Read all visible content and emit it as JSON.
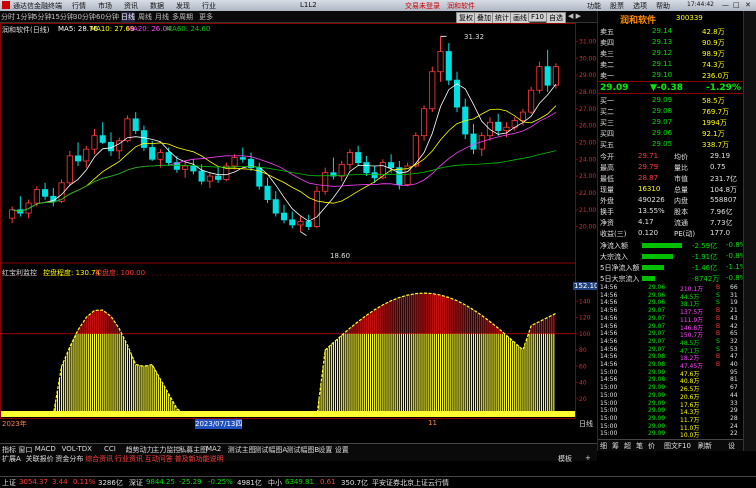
{
  "colors": {
    "up": "#ff3b3b",
    "down": "#00e0e0",
    "ma5": "#ffffff",
    "ma10": "#ffff00",
    "ma20": "#ff40ff",
    "ma60": "#00c000",
    "bull": "#ffff30",
    "hot": "#c01010"
  },
  "titlebar": {
    "app": "通达信金融终端",
    "menu": [
      "行情",
      "市场",
      "资讯",
      "数据",
      "发现",
      "行业",
      "L1L2"
    ],
    "notice": "交易未登录",
    "broker": "润和软件",
    "right": [
      "功能",
      "股票",
      "选项",
      "帮助"
    ]
  },
  "subbar": {
    "periods": [
      "分时",
      "1分钟",
      "5分钟",
      "15分钟",
      "30分钟",
      "60分钟",
      "日线",
      "周线",
      "月线",
      "多周期",
      "更多"
    ],
    "active": "日线",
    "tools": [
      "复权",
      "叠加",
      "统计",
      "画线",
      "F10",
      "自选"
    ],
    "nav": "◀ ▶"
  },
  "main": {
    "header": "润和软件(日线)",
    "ma": [
      {
        "label": "MA5: 28.76",
        "color": "#ffffff"
      },
      {
        "label": "MA10: 27.69",
        "color": "#ffff00"
      },
      {
        "label": "MA20: 26.04",
        "color": "#ff40ff"
      },
      {
        "label": "MA60: 24.60",
        "color": "#00c000"
      }
    ],
    "price_ticks": [
      "31.00",
      "30.00",
      "29.00",
      "28.00",
      "27.00",
      "26.00",
      "25.00",
      "24.00",
      "23.00",
      "22.00",
      "21.00",
      "20.00"
    ],
    "high_label": "31.32",
    "low_label": "18.60",
    "indicator": {
      "name": "红宝利监控",
      "label1": "控盘程度: 130.74",
      "label2": "控盘度: 100.00",
      "value": "152.10",
      "ticks": [
        "140",
        "120",
        "100",
        "80",
        "60",
        "40",
        "20"
      ]
    },
    "dates": [
      "2023年",
      "2023/07/13四",
      "11"
    ],
    "date_tag": "日线"
  },
  "candles": [
    [
      20.5,
      21.2,
      20.2,
      21.0
    ],
    [
      21.0,
      21.8,
      20.6,
      20.8
    ],
    [
      20.8,
      21.6,
      20.5,
      21.4
    ],
    [
      21.4,
      22.4,
      21.2,
      22.2
    ],
    [
      22.2,
      22.6,
      21.6,
      21.8
    ],
    [
      21.8,
      22.3,
      21.2,
      21.5
    ],
    [
      21.5,
      22.8,
      21.4,
      22.6
    ],
    [
      22.6,
      24.5,
      22.4,
      24.2
    ],
    [
      24.2,
      25.0,
      23.6,
      23.9
    ],
    [
      23.9,
      24.8,
      23.5,
      24.6
    ],
    [
      24.6,
      25.8,
      24.3,
      25.4
    ],
    [
      25.4,
      26.2,
      24.9,
      25.0
    ],
    [
      25.0,
      25.6,
      24.2,
      24.5
    ],
    [
      24.5,
      25.3,
      24.0,
      25.1
    ],
    [
      25.1,
      26.6,
      25.0,
      26.4
    ],
    [
      26.4,
      26.8,
      25.5,
      25.7
    ],
    [
      25.7,
      26.0,
      24.5,
      24.7
    ],
    [
      24.7,
      25.1,
      23.9,
      24.0
    ],
    [
      24.0,
      24.6,
      23.5,
      24.4
    ],
    [
      24.4,
      24.7,
      23.6,
      23.8
    ],
    [
      23.8,
      24.2,
      23.2,
      23.4
    ],
    [
      23.4,
      23.9,
      22.9,
      23.6
    ],
    [
      23.6,
      24.0,
      23.1,
      23.3
    ],
    [
      23.3,
      23.7,
      22.5,
      22.7
    ],
    [
      22.7,
      23.2,
      22.3,
      23.0
    ],
    [
      23.0,
      23.5,
      22.6,
      22.8
    ],
    [
      22.8,
      23.8,
      22.7,
      23.6
    ],
    [
      23.6,
      24.3,
      23.4,
      24.1
    ],
    [
      24.1,
      24.7,
      23.8,
      24.0
    ],
    [
      24.0,
      24.4,
      23.3,
      23.5
    ],
    [
      23.5,
      23.8,
      22.2,
      22.4
    ],
    [
      22.4,
      22.9,
      21.4,
      21.6
    ],
    [
      21.6,
      22.1,
      20.6,
      20.8
    ],
    [
      20.8,
      21.3,
      20.2,
      20.4
    ],
    [
      20.4,
      20.9,
      19.9,
      20.1
    ],
    [
      20.1,
      20.6,
      19.7,
      20.3
    ],
    [
      20.3,
      20.7,
      19.8,
      20.0
    ],
    [
      20.0,
      22.4,
      19.9,
      22.1
    ],
    [
      22.1,
      23.5,
      21.9,
      23.2
    ],
    [
      23.2,
      24.1,
      22.8,
      23.0
    ],
    [
      23.0,
      23.9,
      22.7,
      23.7
    ],
    [
      23.7,
      24.6,
      23.4,
      24.4
    ],
    [
      24.4,
      24.8,
      23.6,
      23.8
    ],
    [
      23.8,
      24.2,
      23.0,
      23.2
    ],
    [
      23.2,
      23.6,
      22.6,
      22.9
    ],
    [
      22.9,
      24.0,
      22.8,
      23.8
    ],
    [
      23.8,
      24.3,
      23.2,
      23.5
    ],
    [
      23.5,
      23.9,
      22.2,
      22.5
    ],
    [
      22.5,
      23.8,
      22.4,
      23.6
    ],
    [
      23.6,
      25.6,
      23.5,
      25.4
    ],
    [
      25.4,
      27.2,
      25.1,
      27.0
    ],
    [
      27.0,
      29.5,
      26.8,
      29.2
    ],
    [
      29.2,
      31.3,
      28.6,
      30.4
    ],
    [
      30.4,
      30.9,
      28.4,
      28.7
    ],
    [
      28.7,
      29.2,
      26.8,
      27.1
    ],
    [
      27.1,
      27.6,
      25.2,
      25.5
    ],
    [
      25.5,
      26.1,
      24.3,
      24.6
    ],
    [
      24.6,
      25.6,
      24.2,
      25.4
    ],
    [
      25.4,
      26.5,
      25.1,
      26.2
    ],
    [
      26.2,
      26.7,
      25.4,
      25.7
    ],
    [
      25.7,
      26.2,
      25.3,
      25.9
    ],
    [
      25.9,
      26.5,
      25.7,
      26.3
    ],
    [
      26.3,
      27.0,
      26.0,
      26.8
    ],
    [
      26.8,
      28.3,
      26.7,
      28.1
    ],
    [
      28.1,
      29.8,
      27.9,
      29.5
    ],
    [
      29.5,
      30.5,
      28.0,
      28.4
    ],
    [
      28.4,
      29.7,
      28.2,
      29.5
    ]
  ],
  "right": {
    "logo": "润和软件",
    "code": "300339",
    "price": "29.09",
    "change": "▼-0.38",
    "pct": "-1.29%",
    "sell": [
      {
        "l": "卖五",
        "p": "29.14",
        "v": "42.8万"
      },
      {
        "l": "卖四",
        "p": "29.13",
        "v": "90.9万"
      },
      {
        "l": "卖三",
        "p": "29.12",
        "v": "98.9万"
      },
      {
        "l": "卖二",
        "p": "29.11",
        "v": "74.3万"
      },
      {
        "l": "卖一",
        "p": "29.10",
        "v": "236.0万"
      }
    ],
    "buy": [
      {
        "l": "买一",
        "p": "29.09",
        "v": "58.5万"
      },
      {
        "l": "买二",
        "p": "29.08",
        "v": "769.7万"
      },
      {
        "l": "买三",
        "p": "29.07",
        "v": "1994万"
      },
      {
        "l": "买四",
        "p": "29.06",
        "v": "92.1万"
      },
      {
        "l": "买五",
        "p": "29.05",
        "v": "338.7万"
      }
    ],
    "stats": [
      {
        "a": "今开",
        "b": "29.71",
        "c": "均价",
        "d": "29.19"
      },
      {
        "a": "最高",
        "b": "29.79",
        "c": "量比",
        "d": "0.75"
      },
      {
        "a": "最低",
        "b": "28.87",
        "c": "市值",
        "d": "231.7亿"
      },
      {
        "a": "现量",
        "b": "16310",
        "c": "总量",
        "d": "104.8万"
      },
      {
        "a": "外盘",
        "b": "490226",
        "c": "内盘",
        "d": "558807"
      },
      {
        "a": "换手",
        "b": "13.55%",
        "c": "股本",
        "d": "7.96亿"
      },
      {
        "a": "净资",
        "b": "4.17",
        "c": "流通",
        "d": "7.73亿"
      },
      {
        "a": "收益(三)",
        "b": "0.120",
        "c": "PE(动)",
        "d": "177.0"
      }
    ],
    "flows": [
      {
        "l": "净流入额",
        "v": "-2.59亿",
        "p": "-0.8%",
        "w": 0.9
      },
      {
        "l": "大宗流入",
        "v": "-1.91亿",
        "p": "-0.8%",
        "w": 0.7
      },
      {
        "l": "5日净流入额",
        "v": "-1.46亿",
        "p": "-1.1%",
        "w": 0.5
      },
      {
        "l": "5日大宗流入",
        "v": "-8742万",
        "p": "-0.8%",
        "w": 0.3
      }
    ],
    "ticks": [
      [
        "14:56",
        "29.06",
        "210.1万",
        "B",
        "66"
      ],
      [
        "14:56",
        "29.06",
        "44.5万",
        "S",
        "31"
      ],
      [
        "14:56",
        "29.06",
        "38.1万",
        "S",
        "19"
      ],
      [
        "14:56",
        "29.07",
        "137.5万",
        "B",
        "21"
      ],
      [
        "14:56",
        "29.07",
        "111.9万",
        "B",
        "43"
      ],
      [
        "14:56",
        "29.07",
        "146.8万",
        "B",
        "42"
      ],
      [
        "14:56",
        "29.07",
        "150.7万",
        "B",
        "65"
      ],
      [
        "14:56",
        "29.07",
        "48.5万",
        "S",
        "32"
      ],
      [
        "14:56",
        "29.07",
        "47.1万",
        "S",
        "53"
      ],
      [
        "14:56",
        "29.08",
        "18.2万",
        "B",
        "47"
      ],
      [
        "14:56",
        "29.08",
        "47.45万",
        "B",
        "40"
      ],
      [
        "15:00",
        "29.09",
        "47.6万",
        "",
        "95"
      ],
      [
        "14:56",
        "29.08",
        "40.8万",
        "",
        "81"
      ],
      [
        "15:00",
        "29.09",
        "26.5万",
        "",
        "67"
      ],
      [
        "15:00",
        "29.09",
        "20.6万",
        "",
        "44"
      ],
      [
        "15:00",
        "29.09",
        "17.6万",
        "",
        "33"
      ],
      [
        "15:00",
        "29.09",
        "14.3万",
        "",
        "29"
      ],
      [
        "15:00",
        "29.09",
        "11.7万",
        "",
        "28"
      ],
      [
        "15:00",
        "29.09",
        "11.0万",
        "",
        "24"
      ],
      [
        "15:00",
        "29.09",
        "10.0万",
        "",
        "22"
      ]
    ],
    "tabs": [
      "细",
      "筹",
      "超",
      "笔",
      "价",
      "图文F10",
      "刷新",
      "设"
    ]
  },
  "bottomtabs": {
    "row1": [
      "指标",
      "窗口",
      "MACD",
      "VOL-TDX",
      "CCI",
      "趋势动力",
      "主力监控",
      "私募主图",
      "MA2",
      "测试主图",
      "测试幅图A",
      "测试幅图B",
      "设置",
      "设置"
    ],
    "row2": [
      "扩展A",
      "关联报价",
      "资金分布",
      "综合资讯",
      "行业资讯",
      "互动问答",
      "普及新功能说明"
    ],
    "right": [
      "模板",
      "+"
    ]
  },
  "statusbar": [
    {
      "t": "上证",
      "c": "#e0e0e0"
    },
    {
      "t": "3054.37",
      "c": "#ff3b3b"
    },
    {
      "t": "3.44",
      "c": "#ff3b3b"
    },
    {
      "t": "0.11%",
      "c": "#ff3b3b"
    },
    {
      "t": "3286亿",
      "c": "#e0e0e0"
    },
    {
      "t": "深证",
      "c": "#e0e0e0"
    },
    {
      "t": "9844.25",
      "c": "#00e000"
    },
    {
      "t": "-25.29",
      "c": "#00e000"
    },
    {
      "t": "-0.25%",
      "c": "#00e000"
    },
    {
      "t": "4981亿",
      "c": "#e0e0e0"
    },
    {
      "t": "中小",
      "c": "#e0e0e0"
    },
    {
      "t": "6349.81",
      "c": "#00e000"
    },
    {
      "t": "0.61",
      "c": "#ff3b3b"
    },
    {
      "t": "350.7亿",
      "c": "#e0e0e0"
    },
    {
      "t": "平安证券北京上证云行情",
      "c": "#e0e0e0"
    }
  ]
}
